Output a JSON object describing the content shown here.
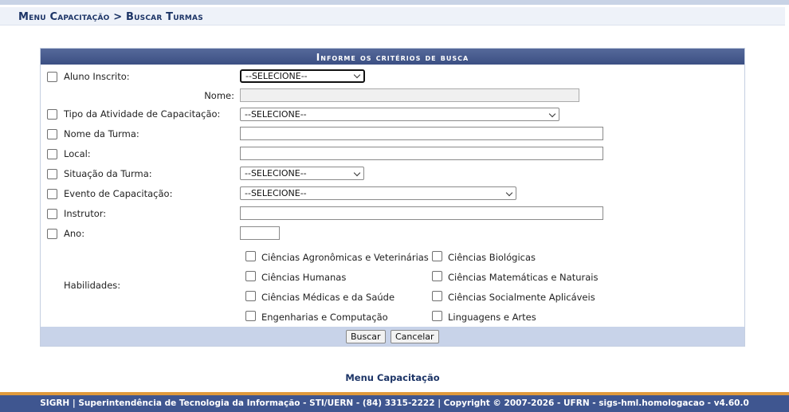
{
  "breadcrumb": {
    "root": "Menu Capacitação",
    "separator": ">",
    "current": "Buscar Turmas"
  },
  "form": {
    "title": "Informe os critérios de busca",
    "fields": {
      "aluno_inscrito": {
        "label": "Aluno Inscrito:",
        "select_value": "--SELECIONE--"
      },
      "nome": {
        "label": "Nome:",
        "value": ""
      },
      "tipo_atividade": {
        "label": "Tipo da Atividade de Capacitação:",
        "select_value": "--SELECIONE--"
      },
      "nome_turma": {
        "label": "Nome da Turma:",
        "value": ""
      },
      "local": {
        "label": "Local:",
        "value": ""
      },
      "situacao_turma": {
        "label": "Situação da Turma:",
        "select_value": "--SELECIONE--"
      },
      "evento_capacitacao": {
        "label": "Evento de Capacitação:",
        "select_value": "--SELECIONE--"
      },
      "instrutor": {
        "label": "Instrutor:",
        "value": ""
      },
      "ano": {
        "label": "Ano:",
        "value": ""
      }
    },
    "habilidades": {
      "label": "Habilidades:",
      "options": [
        "Ciências Agronômicas e Veterinárias",
        "Ciências Biológicas",
        "Ciências Humanas",
        "Ciências Matemáticas e Naturais",
        "Ciências Médicas e da Saúde",
        "Ciências Socialmente Aplicáveis",
        "Engenharias e Computação",
        "Linguagens e Artes"
      ]
    },
    "buttons": {
      "search": "Buscar",
      "cancel": "Cancelar"
    }
  },
  "menu_link": "Menu Capacitação",
  "footer": "SIGRH | Superintendência de Tecnologia da Informação - STI/UERN - (84) 3315-2222 | Copyright © 2007-2026 - UFRN - sigs-hml.homologacao - v4.60.0",
  "colors": {
    "header_blue": "#3b4f83",
    "link_blue": "#1d3567",
    "footer_blue": "#3f5690",
    "footer_accent": "#e09a3c"
  }
}
